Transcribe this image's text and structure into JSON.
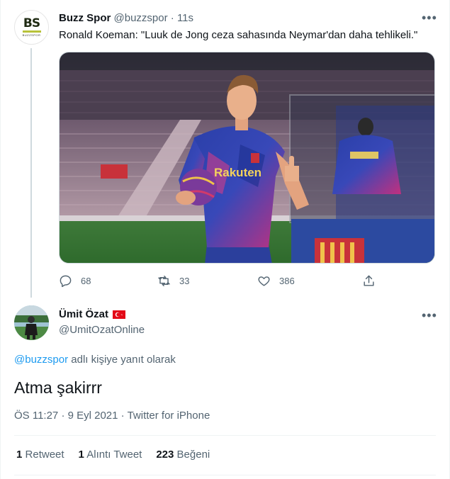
{
  "reply_parent": {
    "author_name": "Buzz Spor",
    "handle": "@buzzspor",
    "time": "11s",
    "avatar_text": "BS",
    "avatar_subtext": "BUZZSPOR",
    "text": "Ronald Koeman: \"Luuk de Jong ceza sahasında Neymar'dan daha tehlikeli.\"",
    "media_logo_text": "Rakuten",
    "actions": {
      "reply_count": "68",
      "retweet_count": "33",
      "like_count": "386"
    }
  },
  "tweet": {
    "author_name": "Ümit Özat",
    "handle": "@UmitOzatOnline",
    "reply_mention": "@buzzspor",
    "reply_suffix": " adlı kişiye yanıt olarak",
    "text": "Atma şakirrr",
    "time": "ÖS 11:27",
    "date": "9 Eyl 2021",
    "source": "Twitter for iPhone",
    "stats": {
      "retweets_count": "1",
      "retweets_label": "Retweet",
      "quotes_count": "1",
      "quotes_label": "Alıntı Tweet",
      "likes_count": "223",
      "likes_label": "Beğeni"
    }
  },
  "colors": {
    "link": "#1d9bf0",
    "secondary_text": "#536471",
    "primary_text": "#0f1419",
    "flag_red": "#e30a17"
  },
  "icons": [
    "more-icon",
    "reply-icon",
    "retweet-icon",
    "like-icon",
    "share-icon",
    "turkey-flag-icon"
  ]
}
